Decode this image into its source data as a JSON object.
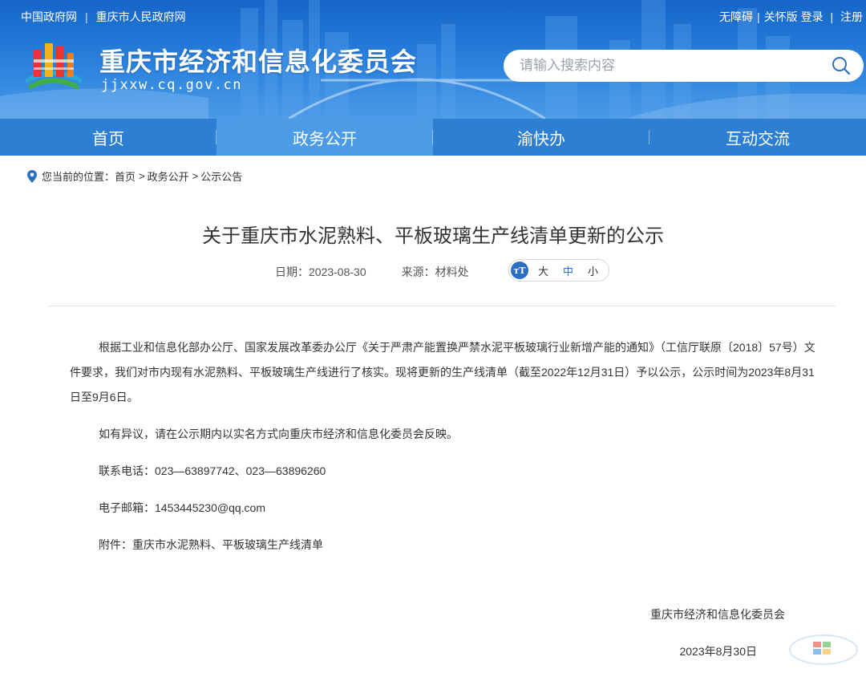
{
  "header": {
    "gov_link1": "中国政府网",
    "gov_link_separator": "|",
    "gov_link2": "重庆市人民政府网",
    "accessibility": "无障碍",
    "care_mode": "关怀版",
    "login": "登录",
    "register": "注册",
    "user_sep": "|",
    "site_title": "重庆市经济和信息化委员会",
    "site_url": "jjxxw.cq.gov.cn",
    "search_placeholder": "请输入搜索内容"
  },
  "nav": {
    "items": [
      "首页",
      "政务公开",
      "渝快办",
      "互动交流"
    ],
    "active_index": 1
  },
  "breadcrumb": {
    "prefix": "您当前的位置：",
    "items": [
      "首页",
      "政务公开",
      "公示公告"
    ],
    "arrow": ">"
  },
  "article": {
    "title": "关于重庆市水泥熟料、平板玻璃生产线清单更新的公示",
    "date_label": "日期：",
    "date": "2023-08-30",
    "source_label": "来源：",
    "source": "材料处",
    "font_icon": "тT",
    "font_sizes": [
      "大",
      "中",
      "小"
    ],
    "paragraphs": [
      "根据工业和信息化部办公厅、国家发展改革委办公厅《关于严肃产能置换严禁水泥平板玻璃行业新增产能的通知》（工信厅联原〔2018〕57号）文件要求，我们对市内现有水泥熟料、平板玻璃生产线进行了核实。现将更新的生产线清单（截至2022年12月31日）予以公示，公示时间为2023年8月31日至9月6日。",
      "如有异议，请在公示期内以实名方式向重庆市经济和信息化委员会反映。",
      "联系电话：023—63897742、023—63896260",
      "电子邮箱：1453445230@qq.com",
      "附件：重庆市水泥熟料、平板玻璃生产线清单"
    ],
    "signature": "重庆市经济和信息化委员会",
    "sign_date": "2023年8月30日"
  },
  "colors": {
    "banner_blue": "#1565c8",
    "nav_blue": "#2d7fd3",
    "nav_active": "#4c9be6",
    "accent": "#2b6fc4"
  },
  "icons": [
    "logo-emblem",
    "search-icon",
    "location-pin-icon",
    "font-size-icon",
    "watermark-logo"
  ]
}
